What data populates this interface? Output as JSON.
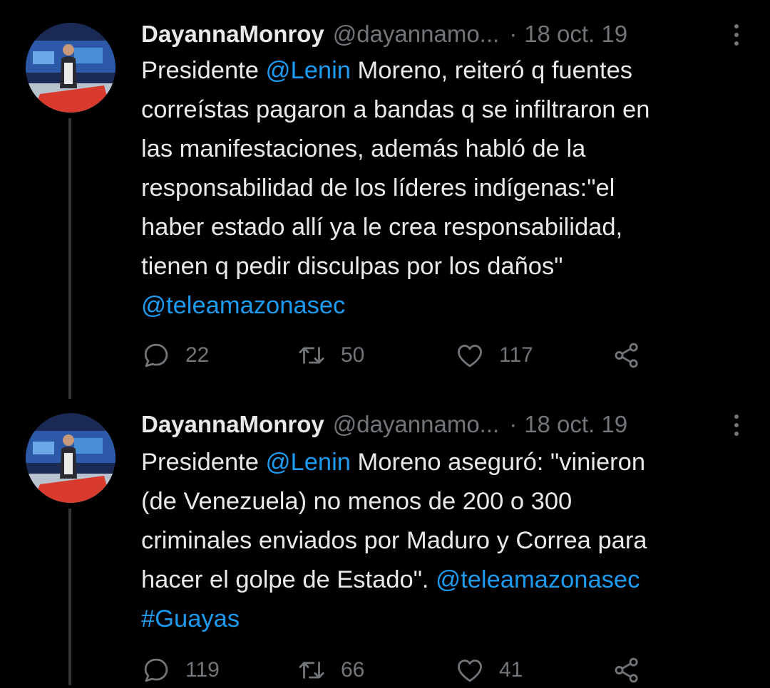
{
  "tweets": [
    {
      "author": {
        "name": "DayannaMonroy",
        "handle": "@dayannamo..."
      },
      "separator": "·",
      "date": "18 oct. 19",
      "text_lines": [
        [
          {
            "t": "Presidente ",
            "link": false
          },
          {
            "t": "@Lenin",
            "link": true
          },
          {
            "t": " Moreno, reiteró q fuentes",
            "link": false
          }
        ],
        [
          {
            "t": "correístas pagaron a bandas q se infiltraron en",
            "link": false
          }
        ],
        [
          {
            "t": "las manifestaciones, además habló de la",
            "link": false
          }
        ],
        [
          {
            "t": "responsabilidad de los líderes indígenas:\"el",
            "link": false
          }
        ],
        [
          {
            "t": "haber estado allí ya le crea responsabilidad,",
            "link": false
          }
        ],
        [
          {
            "t": "tienen q pedir disculpas por los daños\"",
            "link": false
          }
        ],
        [
          {
            "t": "@teleamazonasec",
            "link": true
          }
        ]
      ],
      "stats": {
        "replies": "22",
        "retweets": "50",
        "likes": "117"
      }
    },
    {
      "author": {
        "name": "DayannaMonroy",
        "handle": "@dayannamo..."
      },
      "separator": "·",
      "date": "18 oct. 19",
      "text_lines": [
        [
          {
            "t": "Presidente ",
            "link": false
          },
          {
            "t": "@Lenin",
            "link": true
          },
          {
            "t": " Moreno aseguró:  \"vinieron",
            "link": false
          }
        ],
        [
          {
            "t": "(de Venezuela) no menos de 200 o 300",
            "link": false
          }
        ],
        [
          {
            "t": "criminales enviados por Maduro y Correa para",
            "link": false
          }
        ],
        [
          {
            "t": "hacer el golpe de Estado\". ",
            "link": false
          },
          {
            "t": "@teleamazonasec",
            "link": true
          }
        ],
        [
          {
            "t": "#Guayas",
            "link": true
          }
        ]
      ],
      "stats": {
        "replies": "119",
        "retweets": "66",
        "likes": "41"
      }
    }
  ],
  "icons": {
    "reply": "reply-icon",
    "retweet": "retweet-icon",
    "like": "heart-icon",
    "share": "share-icon",
    "more": "more-vertical-icon"
  },
  "colors": {
    "background": "#000000",
    "text": "#e7e9ea",
    "secondary": "#71767b",
    "link": "#1d9bf0",
    "thread_line": "#333639"
  }
}
